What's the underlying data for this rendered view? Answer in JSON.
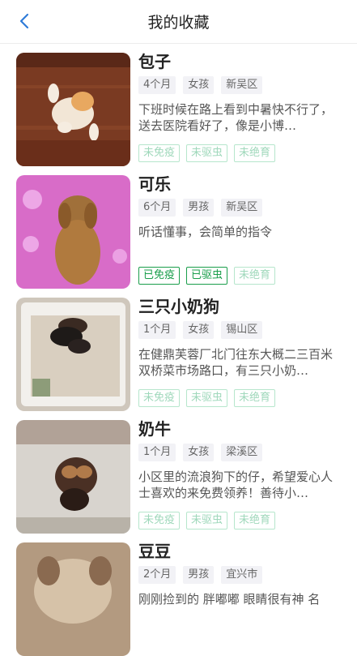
{
  "header": {
    "title": "我的收藏",
    "back_icon": "chevron-left-icon"
  },
  "colors": {
    "accent": "#1a9e4b",
    "inactive": "#9fd8bb",
    "back": "#2f7bd8"
  },
  "pets": [
    {
      "name": "包子",
      "age": "4个月",
      "gender": "女孩",
      "district": "新吴区",
      "desc": "下班时候在路上看到中暑快不行了，送去医院看好了，像是小博…",
      "status": [
        {
          "label": "未免疫",
          "active": false
        },
        {
          "label": "未驱虫",
          "active": false
        },
        {
          "label": "未绝育",
          "active": false
        }
      ]
    },
    {
      "name": "可乐",
      "age": "6个月",
      "gender": "男孩",
      "district": "新吴区",
      "desc": "听话懂事，会简单的指令",
      "status": [
        {
          "label": "已免疫",
          "active": true
        },
        {
          "label": "已驱虫",
          "active": true
        },
        {
          "label": "未绝育",
          "active": false
        }
      ]
    },
    {
      "name": "三只小奶狗",
      "age": "1个月",
      "gender": "女孩",
      "district": "锡山区",
      "desc": "在健鼎芙蓉厂北门往东大概二三百米双桥菜市场路口，有三只小奶…",
      "status": [
        {
          "label": "未免疫",
          "active": false
        },
        {
          "label": "未驱虫",
          "active": false
        },
        {
          "label": "未绝育",
          "active": false
        }
      ]
    },
    {
      "name": "奶牛",
      "age": "1个月",
      "gender": "女孩",
      "district": "梁溪区",
      "desc": "小区里的流浪狗下的仔，希望爱心人士喜欢的来免费领养！善待小…",
      "status": [
        {
          "label": "未免疫",
          "active": false
        },
        {
          "label": "未驱虫",
          "active": false
        },
        {
          "label": "未绝育",
          "active": false
        }
      ]
    },
    {
      "name": "豆豆",
      "age": "2个月",
      "gender": "男孩",
      "district": "宜兴市",
      "desc": "刚刚捡到的 胖嘟嘟 眼睛很有神 名",
      "status": []
    }
  ]
}
